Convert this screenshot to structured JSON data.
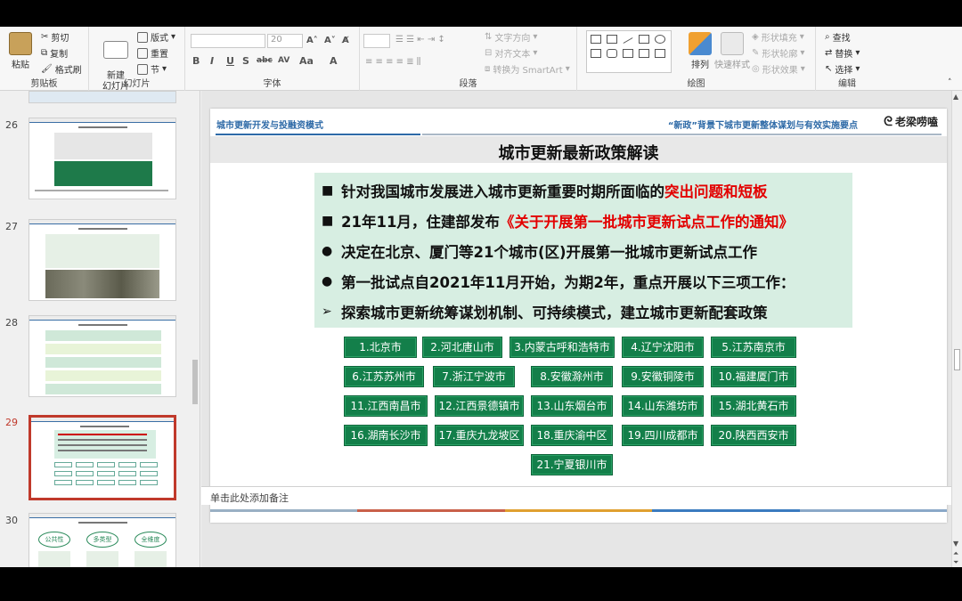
{
  "ribbon": {
    "clipboard": {
      "paste": "粘贴",
      "cut": "剪切",
      "copy": "复制",
      "format_painter": "格式刷",
      "label": "剪贴板"
    },
    "slides": {
      "new_slide": "新建\n幻灯片",
      "layout": "版式",
      "reset": "重置",
      "section": "节",
      "label": "幻灯片"
    },
    "font": {
      "size": "20",
      "label": "字体",
      "buttons": [
        "B",
        "I",
        "U",
        "S",
        "abc",
        "AV",
        "Aa",
        "A"
      ]
    },
    "paragraph": {
      "text_direction": "文字方向",
      "align_text": "对齐文本",
      "smartart": "转换为 SmartArt",
      "label": "段落"
    },
    "drawing": {
      "arrange": "排列",
      "quick_styles": "快速样式",
      "shape_fill": "形状填充",
      "shape_outline": "形状轮廓",
      "shape_effects": "形状效果",
      "label": "绘图"
    },
    "editing": {
      "find": "查找",
      "replace": "替换",
      "select": "选择",
      "label": "编辑"
    }
  },
  "thumbnails": [
    {
      "num": "26"
    },
    {
      "num": "27"
    },
    {
      "num": "28"
    },
    {
      "num": "29",
      "selected": true
    },
    {
      "num": "30",
      "labels": [
        "公共性",
        "多类型",
        "全维度"
      ]
    }
  ],
  "slide": {
    "header_left": "城市更新开发与投融资模式",
    "header_right": "“新政”背景下城市更新整体谋划与有效实施要点",
    "logo": "老梁唠嗑",
    "title": "城市更新最新政策解读",
    "bullets": [
      {
        "marker": "■",
        "text": "针对我国城市发展进入城市更新重要时期所面临的",
        "red": "突出问题和短板"
      },
      {
        "marker": "■",
        "text": "21年11月，住建部发布",
        "red": "《关于开展第一批城市更新试点工作的通知》"
      },
      {
        "marker": "●",
        "text": "决定在北京、厦门等21个城市(区)开展第一批城市更新试点工作",
        "red": ""
      },
      {
        "marker": "●",
        "text": "第一批试点自2021年11月开始，为期2年，重点开展以下三项工作：",
        "red": ""
      },
      {
        "marker": "➢",
        "text": "探索城市更新统筹谋划机制、可持续模式，建立城市更新配套政策",
        "red": ""
      }
    ],
    "cities": [
      [
        "1.北京市",
        "2.河北唐山市",
        "3.内蒙古呼和浩特市",
        "4.辽宁沈阳市",
        "5.江苏南京市"
      ],
      [
        "6.江苏苏州市",
        "7.浙江宁波市",
        "8.安徽滁州市",
        "9.安徽铜陵市",
        "10.福建厦门市"
      ],
      [
        "11.江西南昌市",
        "12.江西景德镇市",
        "13.山东烟台市",
        "14.山东潍坊市",
        "15.湖北黄石市"
      ],
      [
        "16.湖南长沙市",
        "17.重庆九龙坡区",
        "18.重庆渝中区",
        "19.四川成都市",
        "20.陕西西安市"
      ],
      [
        "21.宁夏银川市"
      ]
    ]
  },
  "notes_placeholder": "单击此处添加备注",
  "colors": {
    "accent_red": "#c0392b",
    "city_green": "#137f4a",
    "box_green": "#d7eee2",
    "header_blue": "#2e6aa7"
  }
}
